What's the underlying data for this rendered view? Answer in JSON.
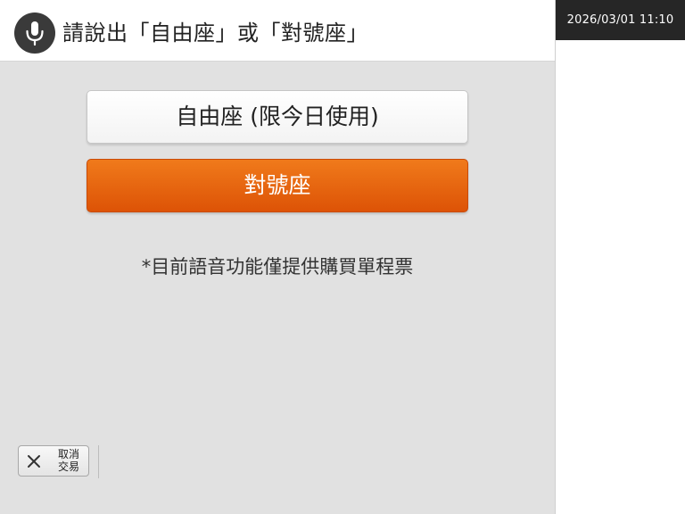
{
  "header": {
    "mic_icon": "microphone-icon",
    "prompt": "請說出「自由座」或「對號座」"
  },
  "status": {
    "datetime": "2026/03/01 11:10"
  },
  "options": {
    "free_seat_label": "自由座 (限今日使用)",
    "reserved_seat_label": "對號座"
  },
  "note": "*目前語音功能僅提供購買單程票",
  "cancel": {
    "icon": "close-icon",
    "line1": "取消",
    "line2": "交易"
  },
  "colors": {
    "accent_orange": "#e8650f",
    "mic_background": "#3a3a3a",
    "panel_gray": "#e1e1e1",
    "datetime_background": "#262626"
  }
}
